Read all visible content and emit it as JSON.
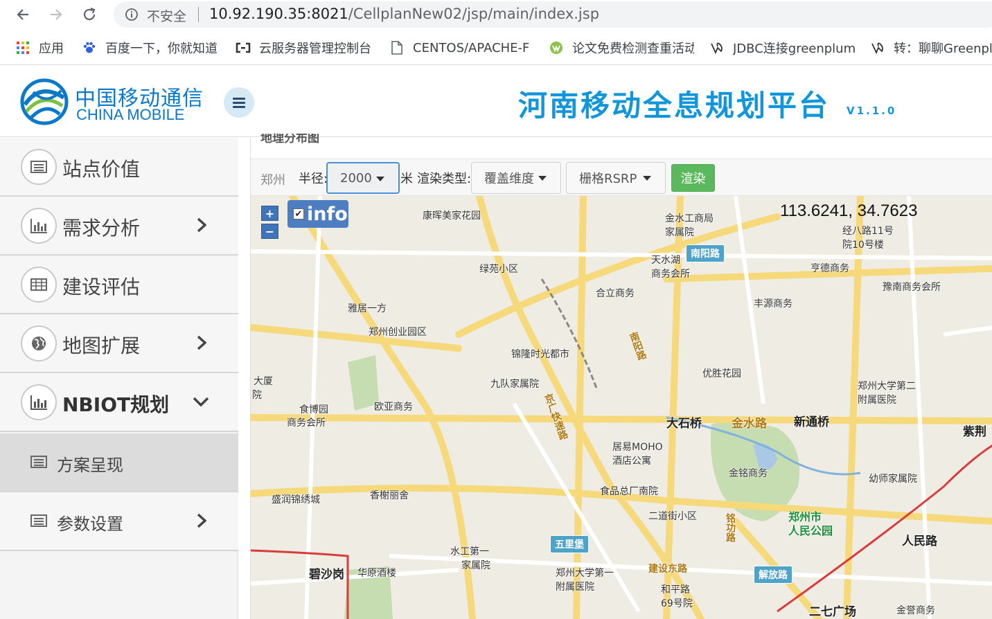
{
  "browser": {
    "security_text": "不安全",
    "url_host": "10.92.190.35:8021",
    "url_path": "/CellplanNew02/jsp/main/index.jsp"
  },
  "bookmarks": [
    {
      "label": "应用",
      "icon": "apps-grid-icon"
    },
    {
      "label": "百度一下，你就知道",
      "icon": "baidu-paw-icon"
    },
    {
      "label": "云服务器管理控制台",
      "icon": "cloud-console-icon"
    },
    {
      "label": "CENTOS/APACHE-F",
      "icon": "document-icon"
    },
    {
      "label": "论文免费检测查重活动",
      "icon": "paper-check-icon"
    },
    {
      "label": "JDBC连接greenplum",
      "icon": "bookmark-site-icon"
    },
    {
      "label": "转：聊聊Greenplum",
      "icon": "bookmark-site-icon"
    }
  ],
  "header": {
    "logo_cn": "中国移动通信",
    "logo_en": "CHINA MOBILE",
    "title": "河南移动全息规划平台",
    "version": "V1.1.0"
  },
  "sidebar": {
    "items": [
      {
        "label": "站点价值",
        "icon": "list-icon",
        "expandable": false
      },
      {
        "label": "需求分析",
        "icon": "bar-chart-icon",
        "expandable": true
      },
      {
        "label": "建设评估",
        "icon": "table-icon",
        "expandable": false
      },
      {
        "label": "地图扩展",
        "icon": "globe-icon",
        "expandable": true
      },
      {
        "label": "NBIOT规划",
        "icon": "bar-chart-icon",
        "expanded": true
      }
    ],
    "subitems": [
      {
        "label": "方案呈现",
        "icon": "list-icon",
        "active": true
      },
      {
        "label": "参数设置",
        "icon": "list-icon",
        "expandable": true
      }
    ]
  },
  "main": {
    "section_title": "地理分布图",
    "toolbar": {
      "city": "郑州",
      "radius_label": "半径:",
      "radius_value": "2000",
      "unit": "米",
      "render_type_label": "渲染类型:",
      "render_type_value": "覆盖维度",
      "metric_value": "栅格RSRP",
      "render_button": "渲染"
    },
    "map": {
      "zoom_in": "+",
      "zoom_out": "−",
      "info_label": "info",
      "info_checked": true,
      "coordinates": "113.6241, 34.7623",
      "labels": {
        "p1": "康晖美家花园",
        "p2": "金水工商局",
        "p2b": "家属院",
        "p3": "经八路11号",
        "p3b": "院10号楼",
        "p4": "绿苑小区",
        "p5": "天水湖",
        "p5b": "商务会所",
        "p6": "亨德商务",
        "p7": "豫南商务会所",
        "p8": "合立商务",
        "p9": "丰源商务",
        "p10": "雅居一方",
        "p11": "郑州创业园区",
        "p12": "锦隆时光都市",
        "p13": "九队家属院",
        "p14": "优胜花园",
        "p15": "郑州大学第二",
        "p15b": "附属医院",
        "p16": "食博园",
        "p16b": "商务会所",
        "p17": "欧亚商务",
        "p18": "大厦",
        "p18b": "院",
        "r1": "大石桥",
        "r2": "金水路",
        "r3": "新通桥",
        "r4": "紫荆",
        "p19": "居易MOHO",
        "p19b": "酒店公寓",
        "p20": "金铭商务",
        "p21": "幼师家属院",
        "p22": "食品总厂南院",
        "p23": "二道街小区",
        "park1": "郑州市",
        "park1b": "人民公园",
        "p24": "盛润锦绣城",
        "p25": "香榭丽舍",
        "r5": "人民路",
        "p26": "水工第一",
        "p26b": "家属院",
        "r6": "碧沙岗",
        "p27": "华原酒楼",
        "p28": "郑州大学第一",
        "p28b": "附属医院",
        "r7": "建设东路",
        "p29": "和平路",
        "p29b": "69号院",
        "r8": "二七广场",
        "p30": "金誉商务",
        "b1": "南阳路",
        "b2": "五里堡",
        "b3": "解放路",
        "v1": "铭功路",
        "v2": "京广快速路",
        "v3": "南阳路"
      }
    }
  }
}
